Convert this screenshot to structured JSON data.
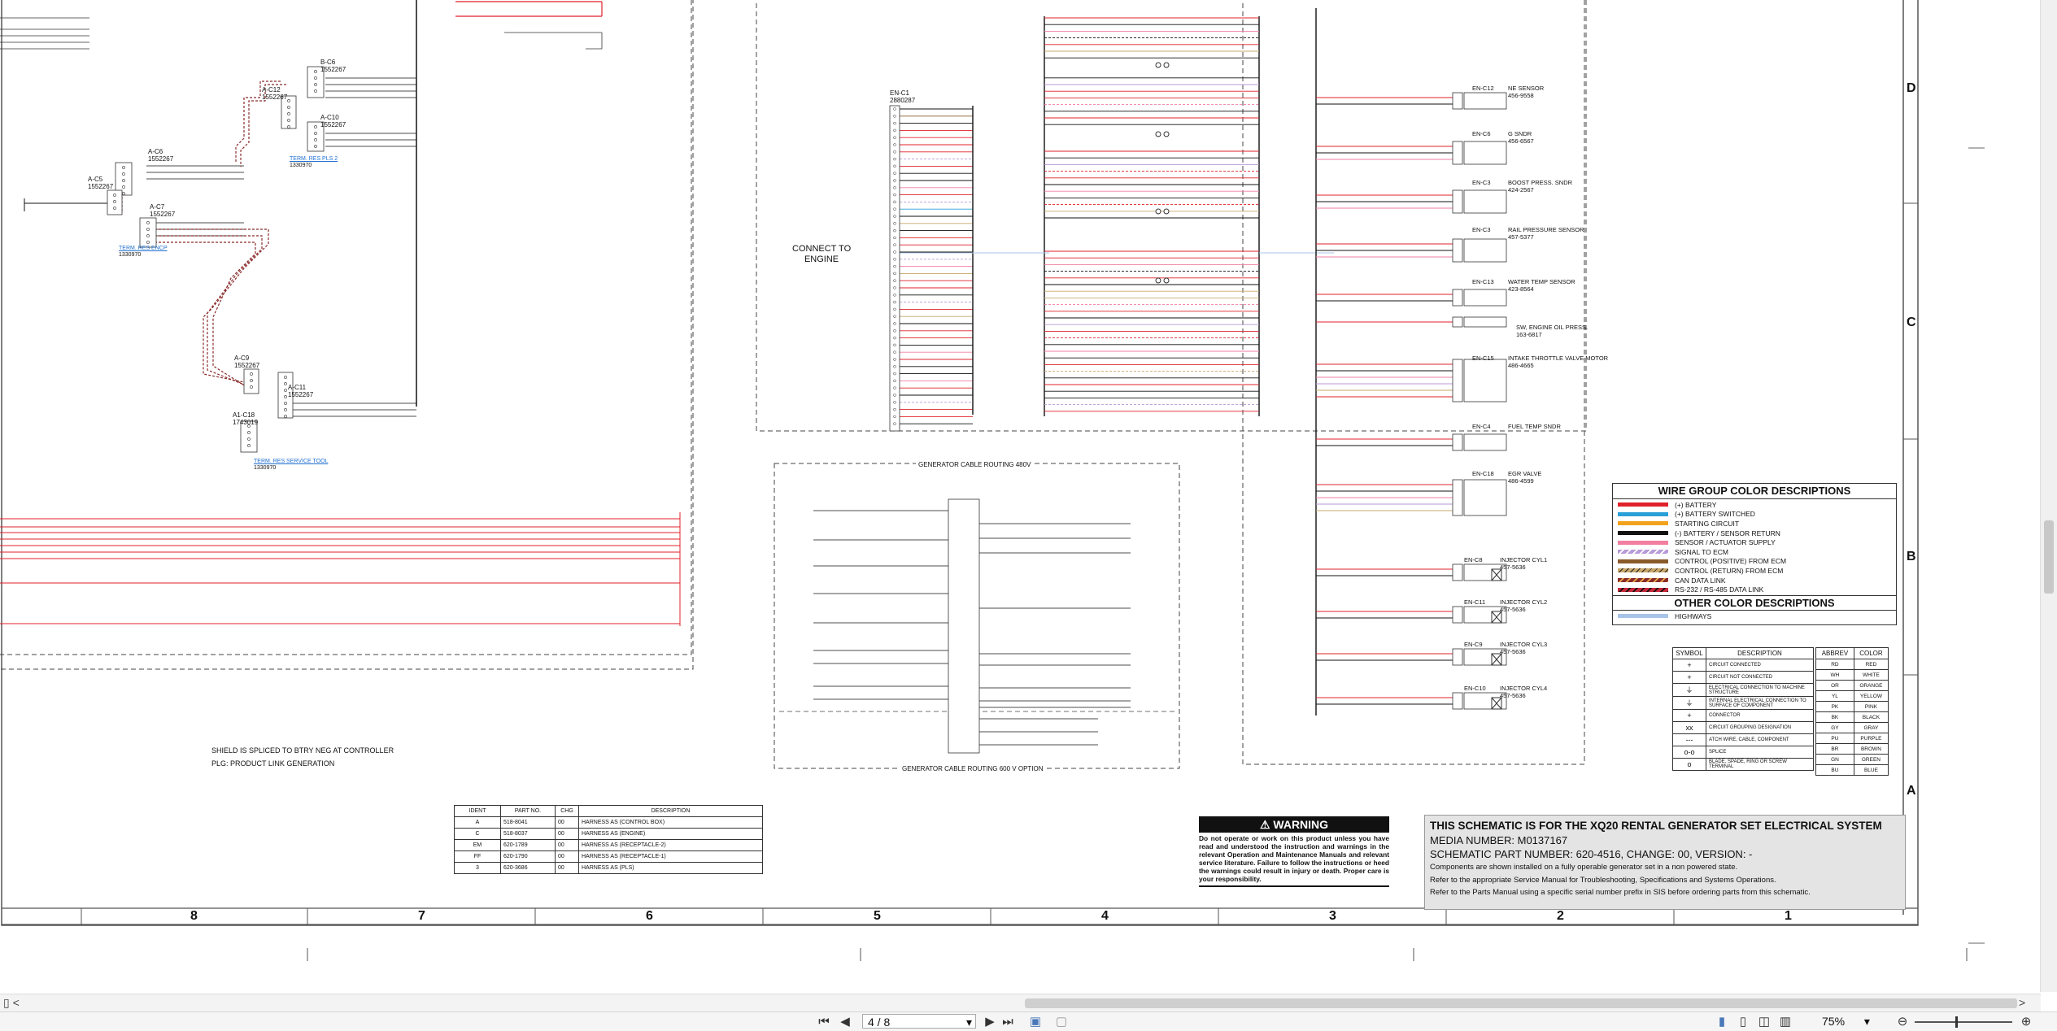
{
  "schematic": {
    "zone_labels_bottom": [
      "8",
      "7",
      "6",
      "5",
      "4",
      "3",
      "2",
      "1"
    ],
    "zone_labels_right": [
      "D",
      "C",
      "B",
      "A"
    ],
    "left_notes": [
      "SHIELD IS SPLICED TO BTRY NEG AT CONTROLLER",
      "PLG: PRODUCT LINK GENERATION"
    ],
    "connect_label": [
      "CONNECT TO",
      "ENGINE"
    ],
    "routing_480": "GENERATOR CABLE ROUTING 480V",
    "routing_600": "GENERATOR CABLE ROUTING 600 V OPTION",
    "left_connectors": [
      {
        "id": "A-C12",
        "part": "1552267"
      },
      {
        "id": "B-C6",
        "part": "1552267"
      },
      {
        "id": "A-C10",
        "part": "1552267"
      },
      {
        "id": "A-C6",
        "part": "1552267"
      },
      {
        "id": "A-C5",
        "part": "1552267"
      },
      {
        "id": "A-C7",
        "part": "1552267"
      },
      {
        "id": "A-C9",
        "part": "1552267"
      },
      {
        "id": "A-C11",
        "part": "1552267"
      },
      {
        "id": "A1-C18",
        "part": "1743019"
      }
    ],
    "terminal_links": [
      {
        "label": "TERM. RES PLS 2",
        "part": "1330970"
      },
      {
        "label": "TERM. RES ENCP",
        "part": "1330970"
      },
      {
        "label": "TERM. RES SERVICE TOOL",
        "part": "1330970"
      }
    ],
    "engine_connector": {
      "id": "EN-C1",
      "part": "2880287"
    },
    "sensors": [
      {
        "id": "EN-C12",
        "name": "NE SENSOR",
        "part": "456-9558"
      },
      {
        "id": "EN-C6",
        "name": "G SNDR",
        "part": "456-6567"
      },
      {
        "id": "EN-C3",
        "name": "BOOST PRESS. SNDR",
        "part": "424-2567"
      },
      {
        "id": "EN-C3",
        "name": "RAIL PRESSURE SENSOR",
        "part": "457-5377"
      },
      {
        "id": "EN-C13",
        "name": "WATER TEMP SENSOR",
        "part": "423-8564"
      },
      {
        "id": "",
        "name": "SW, ENGINE OIL PRESS.",
        "part": "163-6817"
      },
      {
        "id": "EN-C15",
        "name": "INTAKE THROTTLE VALVE MOTOR",
        "part": "486-4665"
      },
      {
        "id": "EN-C4",
        "name": "FUEL TEMP SNDR",
        "part": ""
      },
      {
        "id": "EN-C18",
        "name": "EGR VALVE",
        "part": "486-4599"
      },
      {
        "id": "EN-C8",
        "name": "INJECTOR CYL1",
        "part": "457-5636"
      },
      {
        "id": "EN-C11",
        "name": "INJECTOR CYL2",
        "part": "457-5636"
      },
      {
        "id": "EN-C9",
        "name": "INJECTOR CYL3",
        "part": "457-5636"
      },
      {
        "id": "EN-C10",
        "name": "INJECTOR CYL4",
        "part": "457-5636"
      }
    ],
    "parts_table": {
      "headers": [
        "IDENT",
        "PART NO.",
        "CHG",
        "DESCRIPTION"
      ],
      "rows": [
        [
          "A",
          "518-8041",
          "00",
          "HARNESS AS (CONTROL BOX)"
        ],
        [
          "C",
          "518-8037",
          "00",
          "HARNESS AS (ENGINE)"
        ],
        [
          "EM",
          "620-1789",
          "00",
          "HARNESS AS (RECEPTACLE-2)"
        ],
        [
          "FF",
          "620-1790",
          "00",
          "HARNESS AS (RECEPTACLE-1)"
        ],
        [
          "3",
          "620-3686",
          "00",
          "HARNESS AS (PLS)"
        ]
      ]
    },
    "warning": {
      "title": "WARNING",
      "text": "Do not operate or work on this product unless you have read and understood the instruction and warnings in the relevant Operation and Maintenance Manuals and relevant service literature. Failure to follow the instructions or heed the warnings could result in injury or death. Proper care is your responsibility."
    },
    "title_block": {
      "line1": "THIS SCHEMATIC IS FOR THE XQ20 RENTAL GENERATOR SET ELECTRICAL SYSTEM",
      "line2": "MEDIA NUMBER: M0137167",
      "line3": "SCHEMATIC PART NUMBER: 620-4516, CHANGE: 00, VERSION: -",
      "line4": "Components are shown installed on a fully operable generator set in a non powered state.",
      "line5": "Refer to the appropriate Service Manual for Troubleshooting, Specifications and Systems Operations.",
      "line6": "Refer to the Parts Manual using a specific serial number prefix in SIS before ordering parts from this schematic."
    },
    "wire_legend": {
      "title": "WIRE GROUP COLOR DESCRIPTIONS",
      "items": [
        {
          "label": "(+) BATTERY",
          "color": "#e0222b"
        },
        {
          "label": "(+) BATTERY SWITCHED",
          "color": "#2aa0d8"
        },
        {
          "label": "STARTING CIRCUIT",
          "color": "#f2a21c"
        },
        {
          "label": "(-) BATTERY / SENSOR RETURN",
          "color": "#111111"
        },
        {
          "label": "SENSOR / ACTUATOR SUPPLY",
          "color": "#f27fa0"
        },
        {
          "label": "SIGNAL TO ECM",
          "color": "#b79ad8"
        },
        {
          "label": "CONTROL (POSITIVE) FROM ECM",
          "color": "#8a5a2b"
        },
        {
          "label": "CONTROL (RETURN) FROM ECM",
          "color": "#c9a86a"
        },
        {
          "label": "CAN DATA LINK",
          "color": "#8a2a2a"
        },
        {
          "label": "RS-232 / RS-485 DATA LINK",
          "color": "#c8283a"
        }
      ],
      "other_title": "OTHER COLOR DESCRIPTIONS",
      "other_items": [
        {
          "label": "HIGHWAYS",
          "color": "#a8c4e8"
        }
      ]
    },
    "symbol_table": {
      "headers": [
        "SYMBOL",
        "DESCRIPTION"
      ],
      "rows": [
        [
          "+",
          "CIRCUIT CONNECTED"
        ],
        [
          "+",
          "CIRCUIT NOT CONNECTED"
        ],
        [
          "⏚",
          "ELECTRICAL CONNECTION TO MACHINE STRUCTURE"
        ],
        [
          "⏚",
          "INTERNAL ELECTRICAL CONNECTION TO SURFACE OF COMPONENT"
        ],
        [
          "+",
          "CONNECTOR"
        ],
        [
          "xx",
          "CIRCUIT GROUPING DESIGNATION"
        ],
        [
          "---",
          "ATCH WIRE, CABLE, COMPONENT"
        ],
        [
          "o-o",
          "SPLICE"
        ],
        [
          "o",
          "BLADE, SPADE, RING OR SCREW TERMINAL"
        ]
      ]
    },
    "abbrev_table": {
      "headers": [
        "ABBREV",
        "COLOR"
      ],
      "rows": [
        [
          "RD",
          "RED"
        ],
        [
          "WH",
          "WHITE"
        ],
        [
          "OR",
          "ORANGE"
        ],
        [
          "YL",
          "YELLOW"
        ],
        [
          "PK",
          "PINK"
        ],
        [
          "BK",
          "BLACK"
        ],
        [
          "GY",
          "GRAY"
        ],
        [
          "PU",
          "PURPLE"
        ],
        [
          "BR",
          "BROWN"
        ],
        [
          "GN",
          "GREEN"
        ],
        [
          "BU",
          "BLUE"
        ]
      ]
    }
  },
  "toolbar": {
    "collapse_label": "<",
    "page_value": "4 / 8",
    "zoom_value": "75%",
    "first_page": "⏮",
    "prev_page": "◀",
    "next_page": "▶",
    "last_page": "⏭",
    "zoom_out": "⊖",
    "zoom_in": "⊕",
    "dropdown": "▾"
  }
}
